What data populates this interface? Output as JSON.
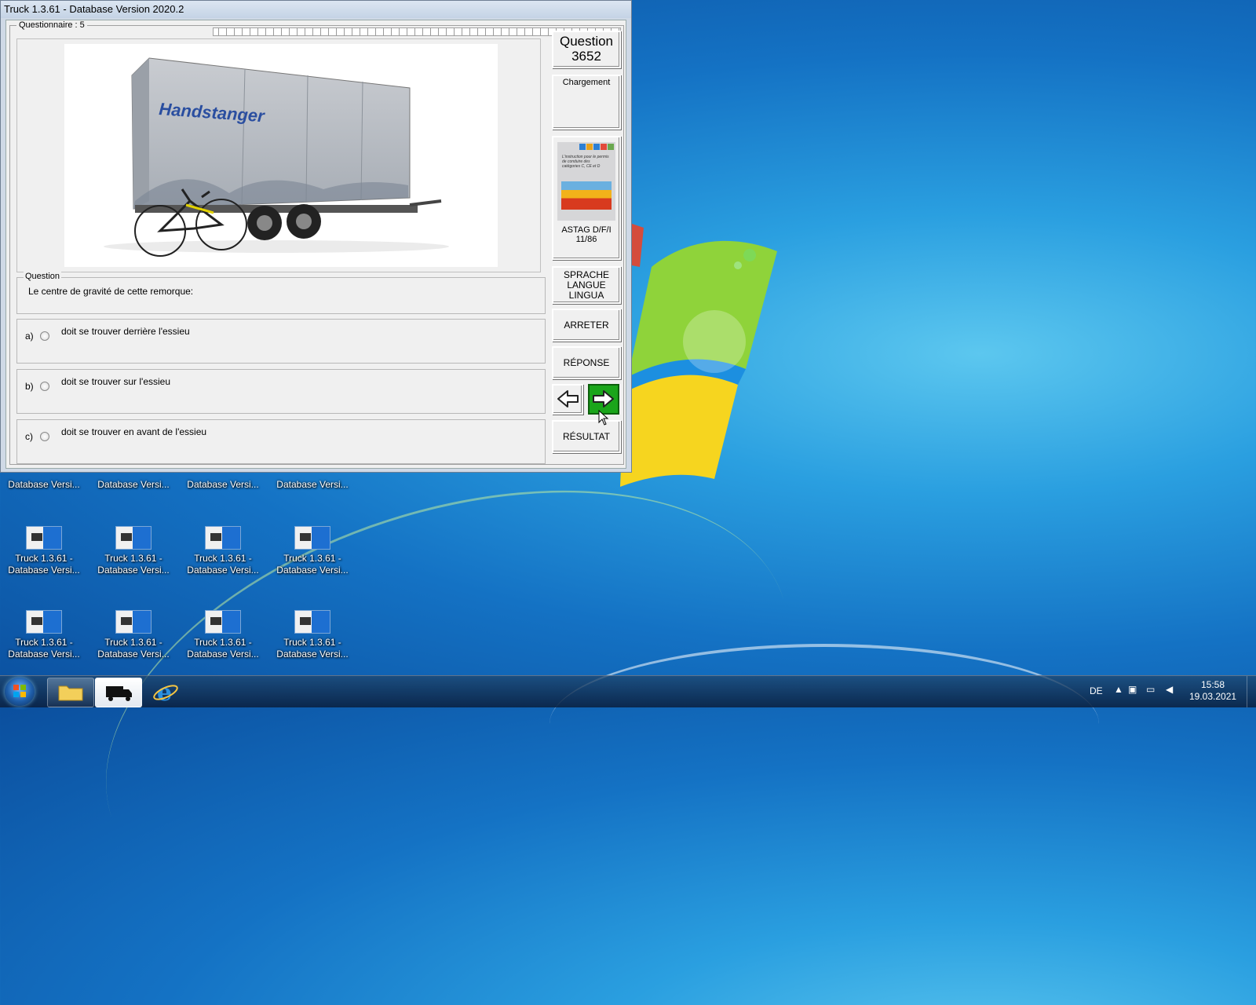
{
  "window": {
    "title": "Truck 1.3.61 - Database Version 2020.2"
  },
  "questionnaire": {
    "label": "Questionnaire : 5"
  },
  "image": {
    "brand_text": "Handstanger"
  },
  "question": {
    "title": "Question",
    "number": "3652",
    "group_label": "Question",
    "text": "Le centre de gravité de cette remorque:"
  },
  "status": {
    "label": "Chargement"
  },
  "book": {
    "caption_line1": "ASTAG D/F/I",
    "caption_line2": "11/86",
    "cover_title": "L'instruction pour le permis de conduire des catégories C, CE et D"
  },
  "answers": [
    {
      "letter": "a)",
      "text": "doit se trouver derrière l'essieu"
    },
    {
      "letter": "b)",
      "text": "doit se trouver sur l'essieu"
    },
    {
      "letter": "c)",
      "text": "doit se trouver en avant de l'essieu"
    }
  ],
  "buttons": {
    "language_line1": "SPRACHE",
    "language_line2": "LANGUE",
    "language_line3": "LINGUA",
    "stop": "ARRETER",
    "answer": "RÉPONSE",
    "result": "RÉSULTAT",
    "prev_icon": "arrow-left-icon",
    "next_icon": "arrow-right-icon"
  },
  "desktop": {
    "partial_label": "Database Versi...",
    "icon_line1": "Truck 1.3.61 -",
    "icon_line2": "Database Versi..."
  },
  "taskbar": {
    "language": "DE",
    "time": "15:58",
    "date": "19.03.2021"
  },
  "colors": {
    "next_button": "#1aa51a",
    "desktop_bg": "#1472c4"
  }
}
